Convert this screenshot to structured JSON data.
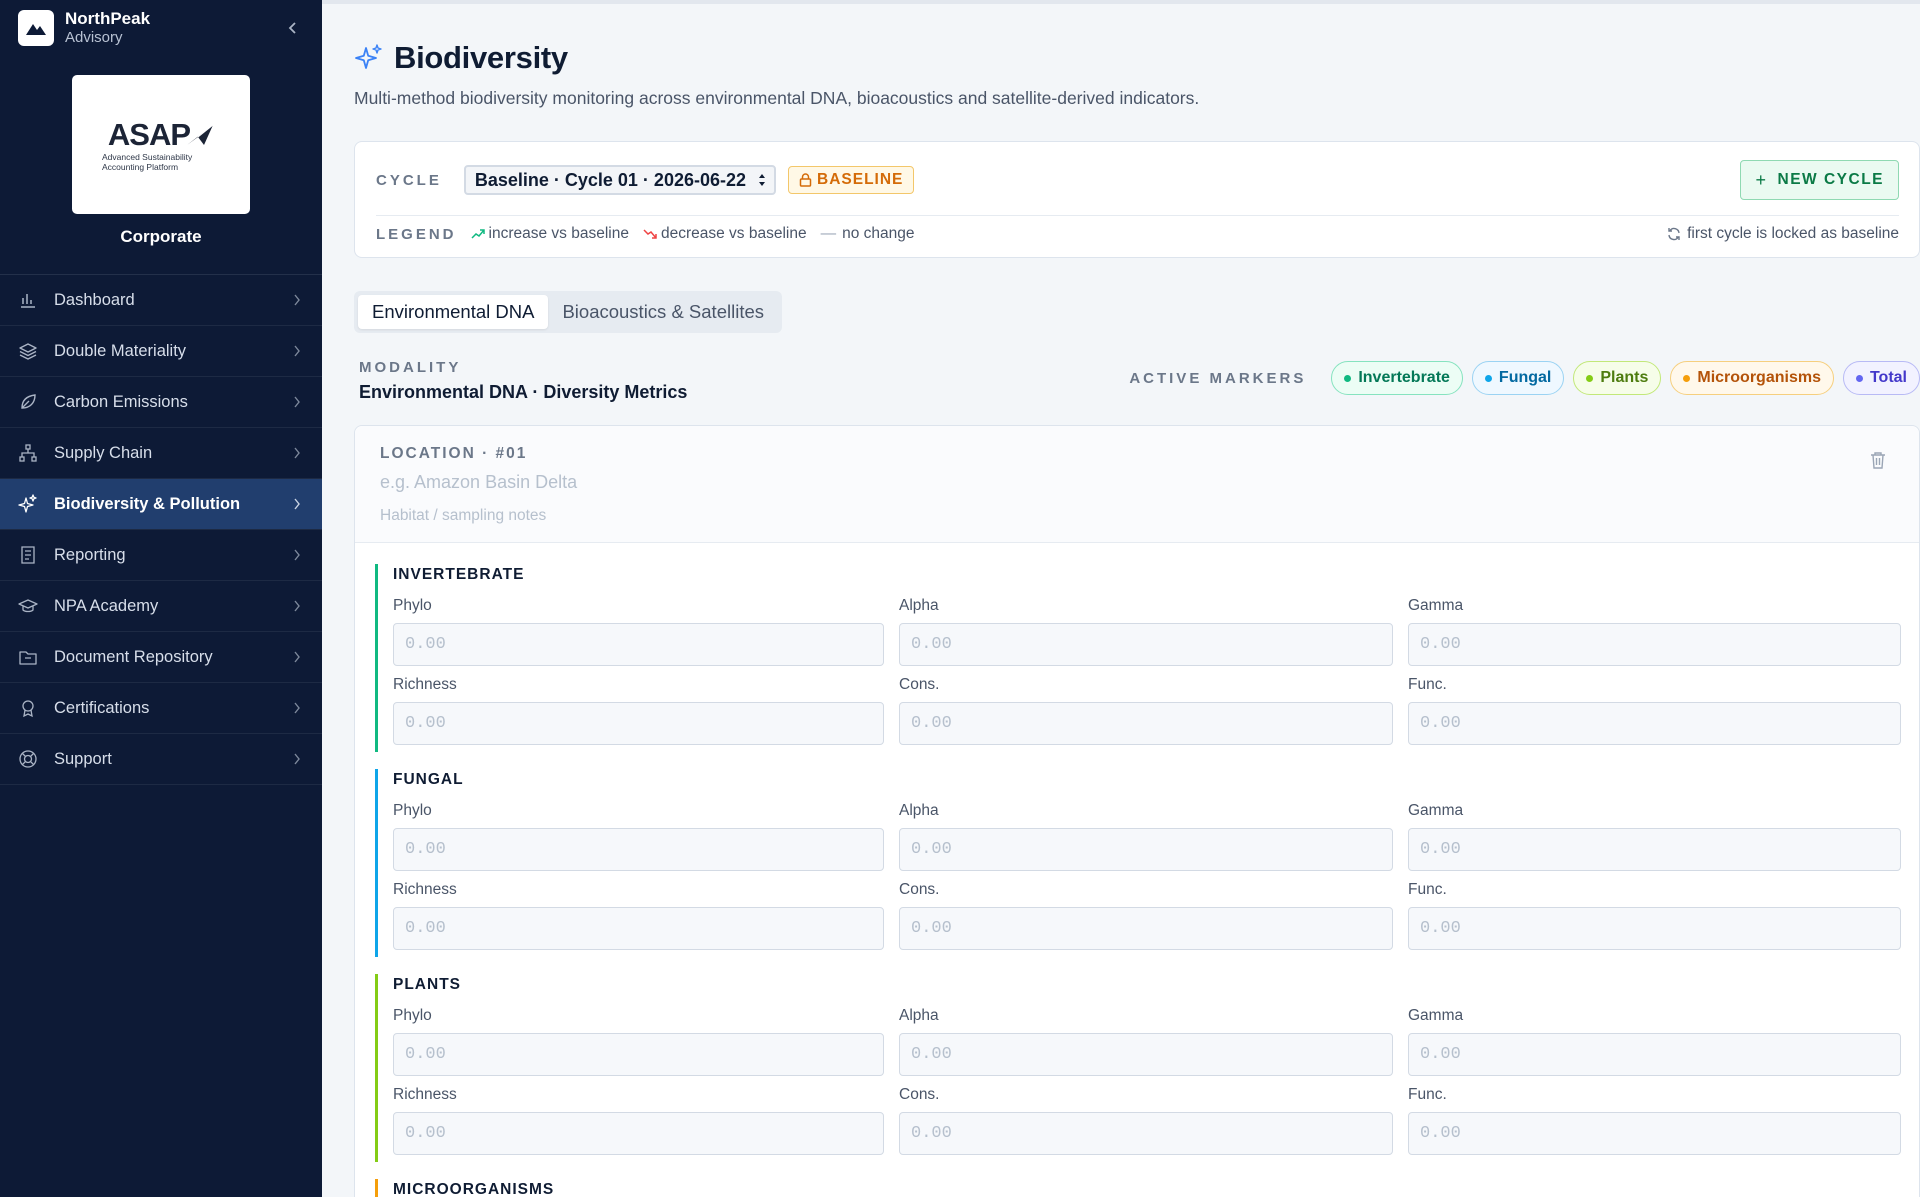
{
  "brand": {
    "name": "NorthPeak",
    "sub": "Advisory"
  },
  "client": {
    "logo_word": "ASAP",
    "logo_line1": "Advanced Sustainability",
    "logo_line2": "Accounting Platform",
    "name": "Corporate"
  },
  "nav": [
    {
      "label": "Dashboard",
      "icon": "bar-chart-icon",
      "active": false
    },
    {
      "label": "Double Materiality",
      "icon": "layers-icon",
      "active": false
    },
    {
      "label": "Carbon Emissions",
      "icon": "leaf-icon",
      "active": false
    },
    {
      "label": "Supply Chain",
      "icon": "network-icon",
      "active": false
    },
    {
      "label": "Biodiversity & Pollution",
      "icon": "sparkles-icon",
      "active": true
    },
    {
      "label": "Reporting",
      "icon": "report-icon",
      "active": false
    },
    {
      "label": "NPA Academy",
      "icon": "graduation-cap-icon",
      "active": false
    },
    {
      "label": "Document Repository",
      "icon": "folder-icon",
      "active": false
    },
    {
      "label": "Certifications",
      "icon": "award-icon",
      "active": false
    },
    {
      "label": "Support",
      "icon": "life-buoy-icon",
      "active": false
    }
  ],
  "page": {
    "title": "Biodiversity",
    "subtitle": "Multi-method biodiversity monitoring across environmental DNA, bioacoustics and satellite-derived indicators."
  },
  "cycle": {
    "label": "CYCLE",
    "selected": "Baseline · Cycle 01 · 2026-06-22",
    "badge": "BASELINE",
    "new_button": "NEW CYCLE",
    "new_button_icon": "+"
  },
  "legend": {
    "label": "LEGEND",
    "increase": "increase vs baseline",
    "decrease": "decrease vs baseline",
    "nochange": "no change",
    "nochange_icon": "—",
    "note": "first cycle is locked as baseline"
  },
  "tabs": [
    {
      "label": "Environmental DNA",
      "active": true
    },
    {
      "label": "Bioacoustics & Satellites",
      "active": false
    }
  ],
  "modality": {
    "label": "MODALITY",
    "value": "Environmental DNA · Diversity Metrics"
  },
  "markers": {
    "label": "ACTIVE MARKERS",
    "items": [
      {
        "label": "Invertebrate",
        "color": "#10b981",
        "bg": "#ecfdf5",
        "border": "#86e3bf",
        "text": "#047857"
      },
      {
        "label": "Fungal",
        "color": "#0ea5e9",
        "bg": "#eff8ff",
        "border": "#9bd3f3",
        "text": "#0369a1"
      },
      {
        "label": "Plants",
        "color": "#84cc16",
        "bg": "#f6fde9",
        "border": "#c2e879",
        "text": "#4d7c0f"
      },
      {
        "label": "Microorganisms",
        "color": "#f59e0b",
        "bg": "#fff8eb",
        "border": "#f6cf7e",
        "text": "#b45309"
      },
      {
        "label": "Total",
        "color": "#6366f1",
        "bg": "#f2f2ff",
        "border": "#b8baf5",
        "text": "#4338ca"
      }
    ]
  },
  "location": {
    "label": "LOCATION · #01",
    "name_placeholder": "e.g. Amazon Basin Delta",
    "notes_placeholder": "Habitat / sampling notes"
  },
  "groups": [
    {
      "title": "INVERTEBRATE",
      "color": "#10b981",
      "fields": [
        {
          "label": "Phylo",
          "placeholder": "0.00"
        },
        {
          "label": "Alpha",
          "placeholder": "0.00"
        },
        {
          "label": "Gamma",
          "placeholder": "0.00"
        },
        {
          "label": "Richness",
          "placeholder": "0.00"
        },
        {
          "label": "Cons.",
          "placeholder": "0.00"
        },
        {
          "label": "Func.",
          "placeholder": "0.00"
        }
      ]
    },
    {
      "title": "FUNGAL",
      "color": "#0ea5e9",
      "fields": [
        {
          "label": "Phylo",
          "placeholder": "0.00"
        },
        {
          "label": "Alpha",
          "placeholder": "0.00"
        },
        {
          "label": "Gamma",
          "placeholder": "0.00"
        },
        {
          "label": "Richness",
          "placeholder": "0.00"
        },
        {
          "label": "Cons.",
          "placeholder": "0.00"
        },
        {
          "label": "Func.",
          "placeholder": "0.00"
        }
      ]
    },
    {
      "title": "PLANTS",
      "color": "#84cc16",
      "fields": [
        {
          "label": "Phylo",
          "placeholder": "0.00"
        },
        {
          "label": "Alpha",
          "placeholder": "0.00"
        },
        {
          "label": "Gamma",
          "placeholder": "0.00"
        },
        {
          "label": "Richness",
          "placeholder": "0.00"
        },
        {
          "label": "Cons.",
          "placeholder": "0.00"
        },
        {
          "label": "Func.",
          "placeholder": "0.00"
        }
      ]
    },
    {
      "title": "MICROORGANISMS",
      "color": "#f59e0b",
      "fields": []
    }
  ]
}
